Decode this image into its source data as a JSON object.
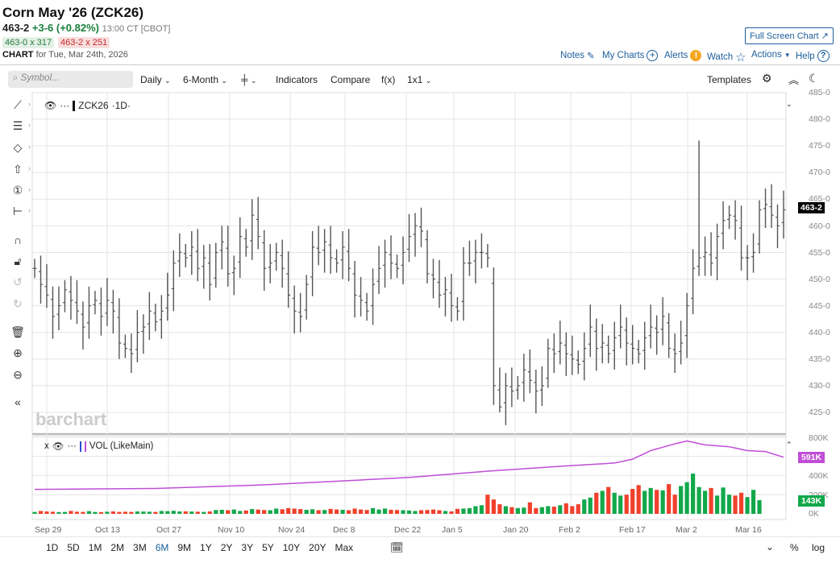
{
  "header": {
    "title": "Corn May '26 (ZCK26)",
    "last": "463-2",
    "change": "+3-6 (+0.82%)",
    "time": "13:00 CT [CBOT]",
    "bid": "463-0 x 317",
    "ask": "463-2 x 251",
    "chart_label": "CHART",
    "chart_date": "for Tue, Mar 24th, 2026",
    "fullscreen": "Full Screen Chart"
  },
  "nav": {
    "notes": "Notes",
    "my_charts": "My Charts",
    "alerts": "Alerts",
    "watch": "Watch",
    "actions": "Actions",
    "help": "Help"
  },
  "toolbar": {
    "search_placeholder": "Symbol...",
    "interval": "Daily",
    "period": "6-Month",
    "indicators": "Indicators",
    "compare": "Compare",
    "fx": "f(x)",
    "layout": "1x1",
    "templates": "Templates"
  },
  "pane": {
    "symbol": "ZCK26",
    "interval": "·1D·",
    "vol_label": "VOL (LikeMain)",
    "watermark": "barchart"
  },
  "price_axis": [
    "485-0",
    "480-0",
    "475-0",
    "470-0",
    "465-0",
    "460-0",
    "455-0",
    "450-0",
    "445-0",
    "440-0",
    "435-0",
    "430-0",
    "425-0"
  ],
  "price_badge": "463-2",
  "vol_axis": [
    "800K",
    "400K",
    "200K",
    "0K"
  ],
  "vol_badges": {
    "oi": "591K",
    "vol": "143K"
  },
  "date_labels": [
    "Sep 29",
    "Oct 13",
    "Oct 27",
    "Nov 10",
    "Nov 24",
    "Dec 8",
    "Dec 22",
    "Jan 5",
    "Jan 20",
    "Feb 2",
    "Feb 17",
    "Mar 2",
    "Mar 16"
  ],
  "range_buttons": [
    "1D",
    "5D",
    "1M",
    "2M",
    "3M",
    "6M",
    "9M",
    "1Y",
    "2Y",
    "3Y",
    "5Y",
    "10Y",
    "20Y",
    "Max"
  ],
  "range_active": "6M",
  "bottom_right": {
    "pct": "%",
    "log": "log"
  },
  "colors": {
    "up": "#12a84a",
    "down": "#f0402c",
    "oi": "#c04ed6",
    "link": "#1c5e9c"
  },
  "chart_data": {
    "type": "bar",
    "title": "Corn May '26 (ZCK26) Daily OHLC",
    "closes": [
      452,
      449,
      447,
      443,
      445,
      448,
      446,
      444,
      441,
      445,
      446,
      443,
      446,
      444,
      438,
      437,
      436,
      440,
      441,
      444,
      442,
      444,
      447,
      453,
      455,
      454,
      456,
      452,
      454,
      449,
      455,
      457,
      451,
      452,
      458,
      456,
      462,
      458,
      452,
      453,
      455,
      452,
      447,
      444,
      443,
      449,
      456,
      455,
      457,
      454,
      453,
      456,
      452,
      447,
      446,
      444,
      449,
      452,
      455,
      453,
      452,
      455,
      458,
      460,
      459,
      451,
      450,
      447,
      448,
      445,
      444,
      453,
      453,
      455,
      455,
      454,
      430,
      426,
      430,
      429,
      430,
      433,
      431,
      429,
      430,
      437,
      436,
      438,
      436,
      435,
      434,
      437,
      441,
      437,
      438,
      436,
      439,
      441,
      438,
      437,
      436,
      439,
      441,
      440,
      443,
      437,
      436,
      438,
      445,
      452,
      454,
      455,
      453,
      458,
      461,
      462,
      461,
      454,
      454,
      455,
      463,
      464,
      462,
      460,
      463
    ],
    "extremes": {
      "max_high": 476,
      "max_high_index": 110,
      "min_low": 425,
      "min_low_index": 77
    },
    "volume_k": [
      20,
      30,
      25,
      22,
      18,
      20,
      30,
      22,
      20,
      28,
      20,
      18,
      22,
      25,
      20,
      22,
      20,
      25,
      24,
      22,
      20,
      30,
      28,
      32,
      25,
      26,
      24,
      22,
      20,
      25,
      40,
      42,
      38,
      45,
      30,
      35,
      50,
      45,
      40,
      38,
      55,
      48,
      60,
      55,
      50,
      42,
      48,
      38,
      40,
      52,
      45,
      42,
      38,
      55,
      45,
      40,
      60,
      45,
      55,
      42,
      40,
      38,
      35,
      30,
      38,
      40,
      45,
      38,
      30,
      25,
      52,
      55,
      60,
      80,
      90,
      200,
      150,
      100,
      80,
      70,
      60,
      65,
      120,
      60,
      70,
      80,
      75,
      90,
      110,
      80,
      100,
      150,
      170,
      220,
      240,
      280,
      220,
      190,
      200,
      260,
      300,
      240,
      270,
      250,
      245,
      310,
      200,
      290,
      330,
      420,
      280,
      240,
      270,
      190,
      275,
      200,
      190,
      220,
      175,
      250,
      143
    ],
    "oi_anchors": [
      [
        0,
        255
      ],
      [
        20,
        265
      ],
      [
        37,
        300
      ],
      [
        50,
        340
      ],
      [
        62,
        380
      ],
      [
        76,
        450
      ],
      [
        88,
        500
      ],
      [
        96,
        530
      ],
      [
        99,
        570
      ],
      [
        102,
        660
      ],
      [
        106,
        730
      ],
      [
        108,
        760
      ],
      [
        111,
        720
      ],
      [
        115,
        700
      ],
      [
        118,
        660
      ],
      [
        121,
        650
      ],
      [
        124,
        591
      ]
    ],
    "ylim": [
      425,
      485
    ],
    "vol_ylim": [
      0,
      800
    ]
  }
}
